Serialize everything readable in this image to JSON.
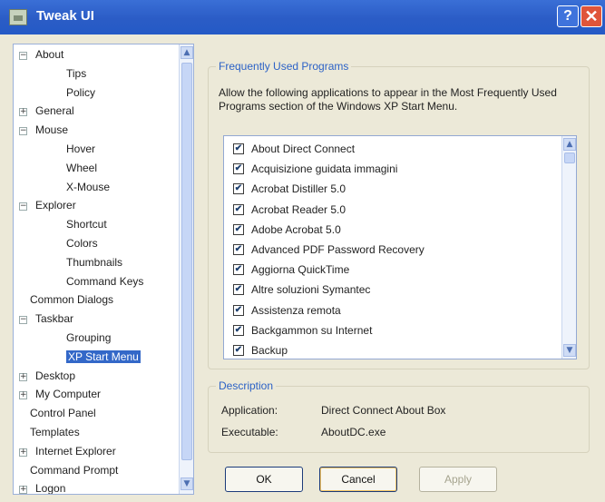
{
  "window": {
    "title": "Tweak UI",
    "help": "?",
    "close": "✕"
  },
  "tree": [
    {
      "label": "About",
      "expander": "−"
    },
    {
      "label": "Tips"
    },
    {
      "label": "Policy"
    },
    {
      "label": "General",
      "expander": "+"
    },
    {
      "label": "Mouse",
      "expander": "−"
    },
    {
      "label": "Hover"
    },
    {
      "label": "Wheel"
    },
    {
      "label": "X-Mouse"
    },
    {
      "label": "Explorer",
      "expander": "−"
    },
    {
      "label": "Shortcut"
    },
    {
      "label": "Colors"
    },
    {
      "label": "Thumbnails"
    },
    {
      "label": "Command Keys"
    },
    {
      "label": "Common Dialogs"
    },
    {
      "label": "Taskbar",
      "expander": "−"
    },
    {
      "label": "Grouping"
    },
    {
      "label": "XP Start Menu",
      "selected": true
    },
    {
      "label": "Desktop",
      "expander": "+"
    },
    {
      "label": "My Computer",
      "expander": "+"
    },
    {
      "label": "Control Panel"
    },
    {
      "label": "Templates"
    },
    {
      "label": "Internet Explorer",
      "expander": "+"
    },
    {
      "label": "Command Prompt"
    },
    {
      "label": "Logon",
      "expander": "+"
    }
  ],
  "frequent": {
    "title": "Frequently Used Programs",
    "description": "Allow the following applications to appear in the Most Frequently Used Programs section of the Windows XP Start Menu.",
    "items": [
      {
        "label": "About Direct Connect",
        "checked": true
      },
      {
        "label": "Acquisizione guidata immagini",
        "checked": true
      },
      {
        "label": "Acrobat Distiller 5.0",
        "checked": true
      },
      {
        "label": "Acrobat Reader 5.0",
        "checked": true
      },
      {
        "label": "Adobe Acrobat 5.0",
        "checked": true
      },
      {
        "label": "Advanced PDF Password Recovery",
        "checked": true
      },
      {
        "label": "Aggiorna QuickTime",
        "checked": true
      },
      {
        "label": "Altre soluzioni Symantec",
        "checked": true
      },
      {
        "label": "Assistenza remota",
        "checked": true
      },
      {
        "label": "Backgammon su Internet",
        "checked": true
      },
      {
        "label": "Backup",
        "checked": true
      }
    ]
  },
  "description_group": {
    "title": "Description",
    "application_label": "Application:",
    "application_value": "Direct Connect About Box",
    "executable_label": "Executable:",
    "executable_value": "AboutDC.exe"
  },
  "buttons": {
    "ok": "OK",
    "cancel": "Cancel",
    "apply": "Apply"
  },
  "icons": {
    "check": "✔",
    "scroll_up": "▲",
    "scroll_down": "▼",
    "help": "?",
    "close": "✕"
  }
}
